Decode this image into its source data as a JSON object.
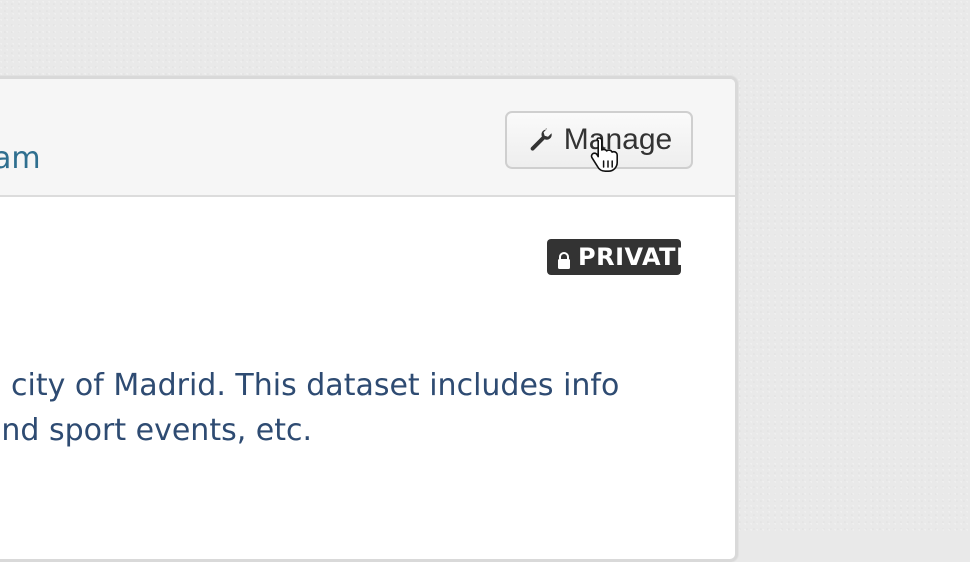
{
  "header": {
    "link_text": "am"
  },
  "toolbar": {
    "manage_label": "Manage",
    "manage_icon": "wrench-icon"
  },
  "badge": {
    "label": "PRIVATE",
    "icon": "lock-icon"
  },
  "description": {
    "lines": [
      "e city of Madrid. This dataset includes info",
      " and sport events, etc."
    ]
  },
  "colors": {
    "link": "#2f6f8f",
    "text": "#2e4b72",
    "badge_bg": "#333333",
    "badge_text": "#ffffff"
  }
}
